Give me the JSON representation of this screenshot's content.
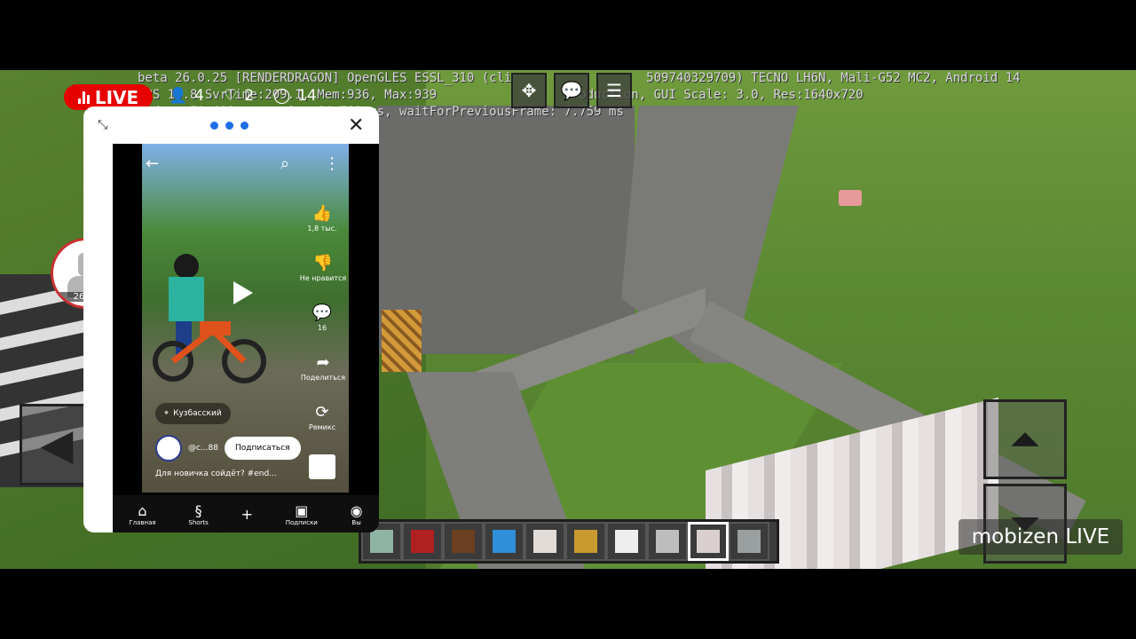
{
  "debug": {
    "line1": "beta 26.0.25 [RENDERDRAGON] OpenGLES ESSL_310 (cli",
    "line1b": "509740329709) TECNO LH6N, Mali-G52 MC2, Android 14",
    "line2": "FPS 15.8 SvrTime:209.1, Mem:936, Max:939",
    "line2b": "Production, GUI Scale: 3.0, Res:1640x720",
    "line3": "ender: 50.408 ms, main: 64.711 ms, waitForPreviousFrame: 7.759 ms"
  },
  "live": {
    "label": "LIVE",
    "viewers": "4",
    "likes": "2",
    "comments": "14"
  },
  "floating_avatar": {
    "timer": "26:19"
  },
  "watermark": "mobizen LIVE",
  "hotbar": {
    "slots": [
      {
        "name": "glass-pane",
        "color": "#8fb3a3"
      },
      {
        "name": "red-wool",
        "color": "#b02020"
      },
      {
        "name": "door",
        "color": "#6b3f1f"
      },
      {
        "name": "light-blue-block",
        "color": "#2f8fd8"
      },
      {
        "name": "stone-slab",
        "color": "#e2dcd8"
      },
      {
        "name": "torch",
        "color": "#c89a30"
      },
      {
        "name": "white-block",
        "color": "#eeeeee"
      },
      {
        "name": "cobblestone",
        "color": "#bdbdbd"
      },
      {
        "name": "stone-bricks",
        "color": "#d9cfcf"
      },
      {
        "name": "more",
        "color": "#9aa0a0"
      }
    ],
    "selected_index": 8
  },
  "youtube": {
    "likes": "1,8 тыс.",
    "dislike_label": "Не нравится",
    "comments": "16",
    "share_label": "Поделиться",
    "remix_label": "Ремикс",
    "location": "Кузбасский",
    "channel": "@c...88",
    "subscribe_label": "Подписаться",
    "description": "Для новичка сойдёт? #end...",
    "nav": [
      {
        "label": "Главная",
        "icon": "home-icon"
      },
      {
        "label": "Shorts",
        "icon": "shorts-icon"
      },
      {
        "label": "",
        "icon": "plus-icon"
      },
      {
        "label": "Подписки",
        "icon": "subscriptions-icon"
      },
      {
        "label": "Вы",
        "icon": "profile-icon"
      }
    ]
  }
}
